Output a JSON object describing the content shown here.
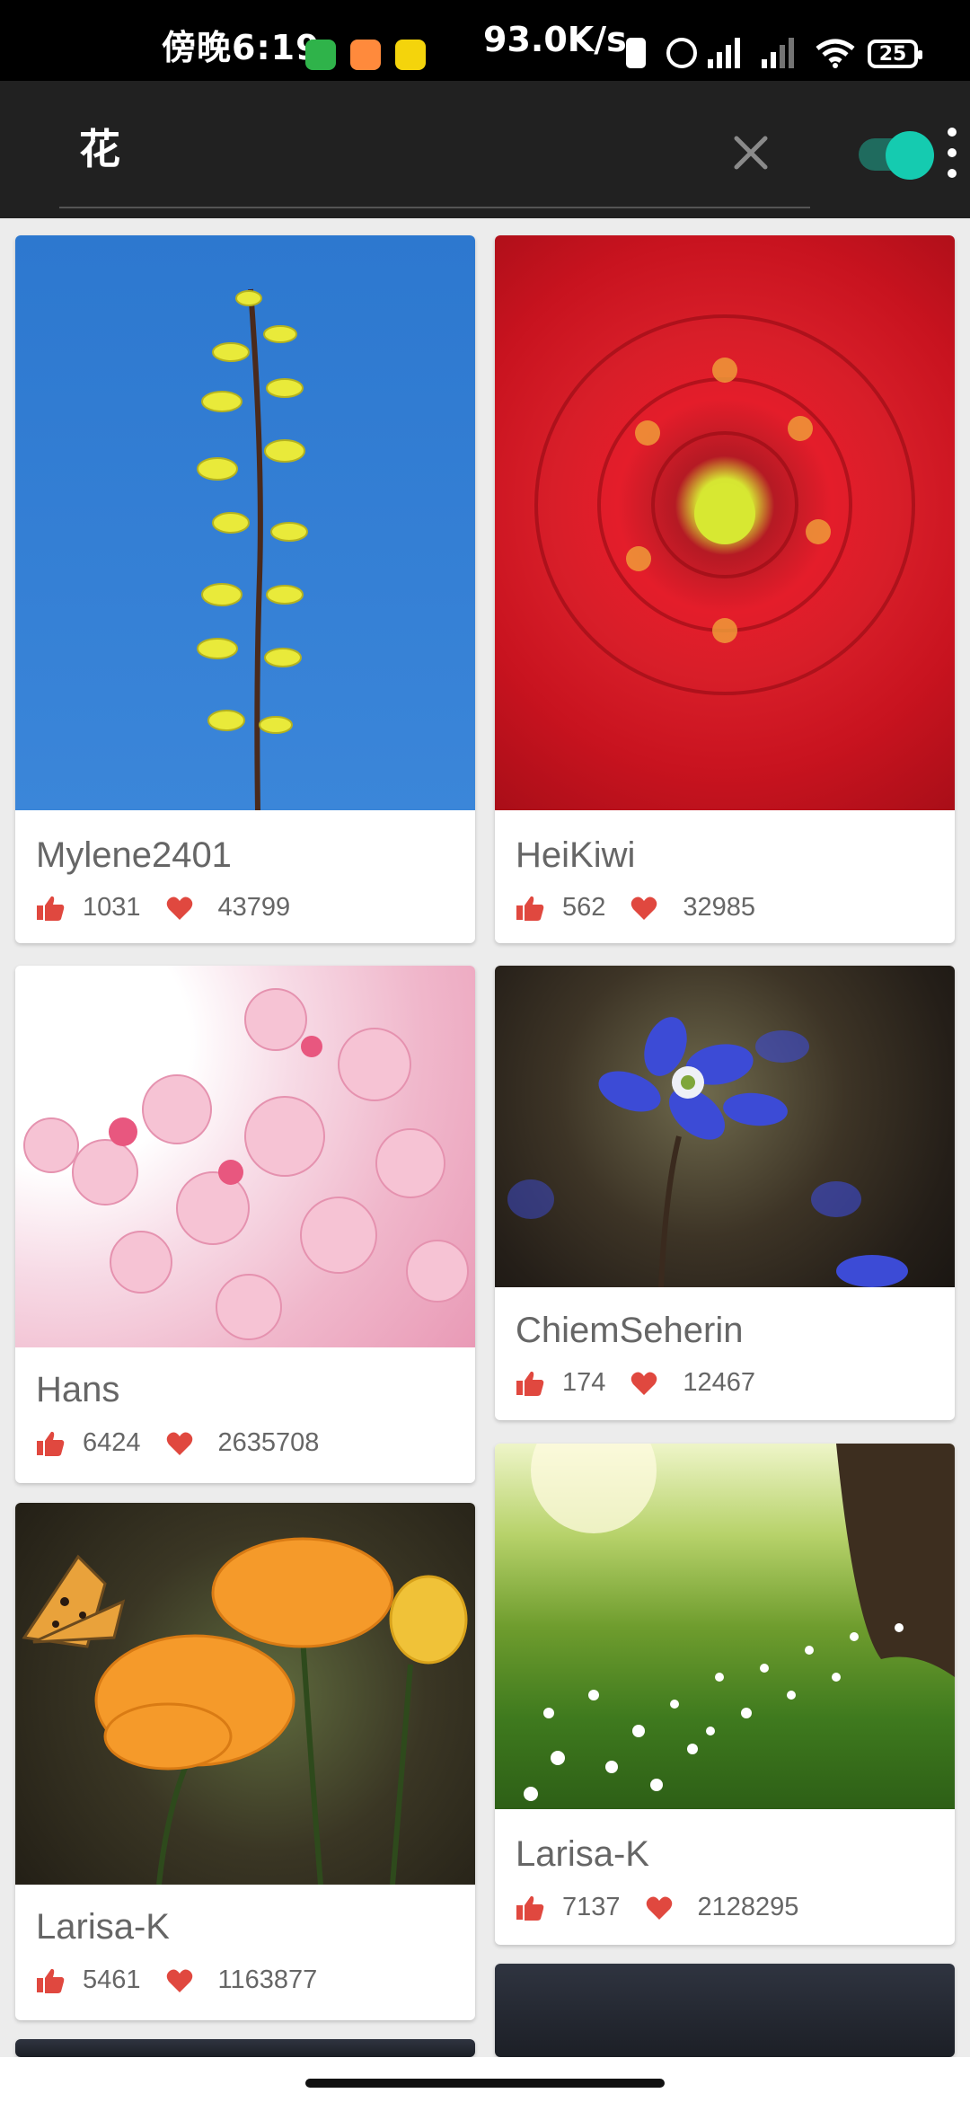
{
  "status_bar": {
    "time": "傍晚6:19",
    "speed": "93.0K/s",
    "battery": "25",
    "icons": [
      "wechat-icon",
      "shopping-app-icon",
      "news-app-icon",
      "vibrate-icon",
      "alarm-icon",
      "signal-hd-icon",
      "signal-hd-2-icon",
      "wifi-icon",
      "battery-icon"
    ],
    "colors": {
      "wechat": "#2fb34a",
      "shopping": "#ff8a3c",
      "news": "#f4d40c"
    }
  },
  "app_bar": {
    "search_query": "花",
    "clear_icon": "close-icon",
    "toggle_on": true,
    "more_icon": "more-vert-icon",
    "accent": "#15cbb0"
  },
  "cards": [
    {
      "author": "Mylene2401",
      "likes": "1031",
      "favorites": "43799",
      "image": "forsythia-branch-blue-sky"
    },
    {
      "author": "HeiKiwi",
      "likes": "562",
      "favorites": "32985",
      "image": "red-dahlia-closeup"
    },
    {
      "author": "Hans",
      "likes": "6424",
      "favorites": "2635708",
      "image": "pink-cherry-blossoms"
    },
    {
      "author": "ChiemSeherin",
      "likes": "174",
      "favorites": "12467",
      "image": "blue-hepatica-flower"
    },
    {
      "author": "Larisa-K",
      "likes": "5461",
      "favorites": "1163877",
      "image": "orange-globeflowers-butterfly"
    },
    {
      "author": "Larisa-K",
      "likes": "7137",
      "favorites": "2128295",
      "image": "meadow-white-flowers-tree"
    }
  ],
  "stat_colors": {
    "like": "#e0483f",
    "favorite": "#e0483f"
  }
}
